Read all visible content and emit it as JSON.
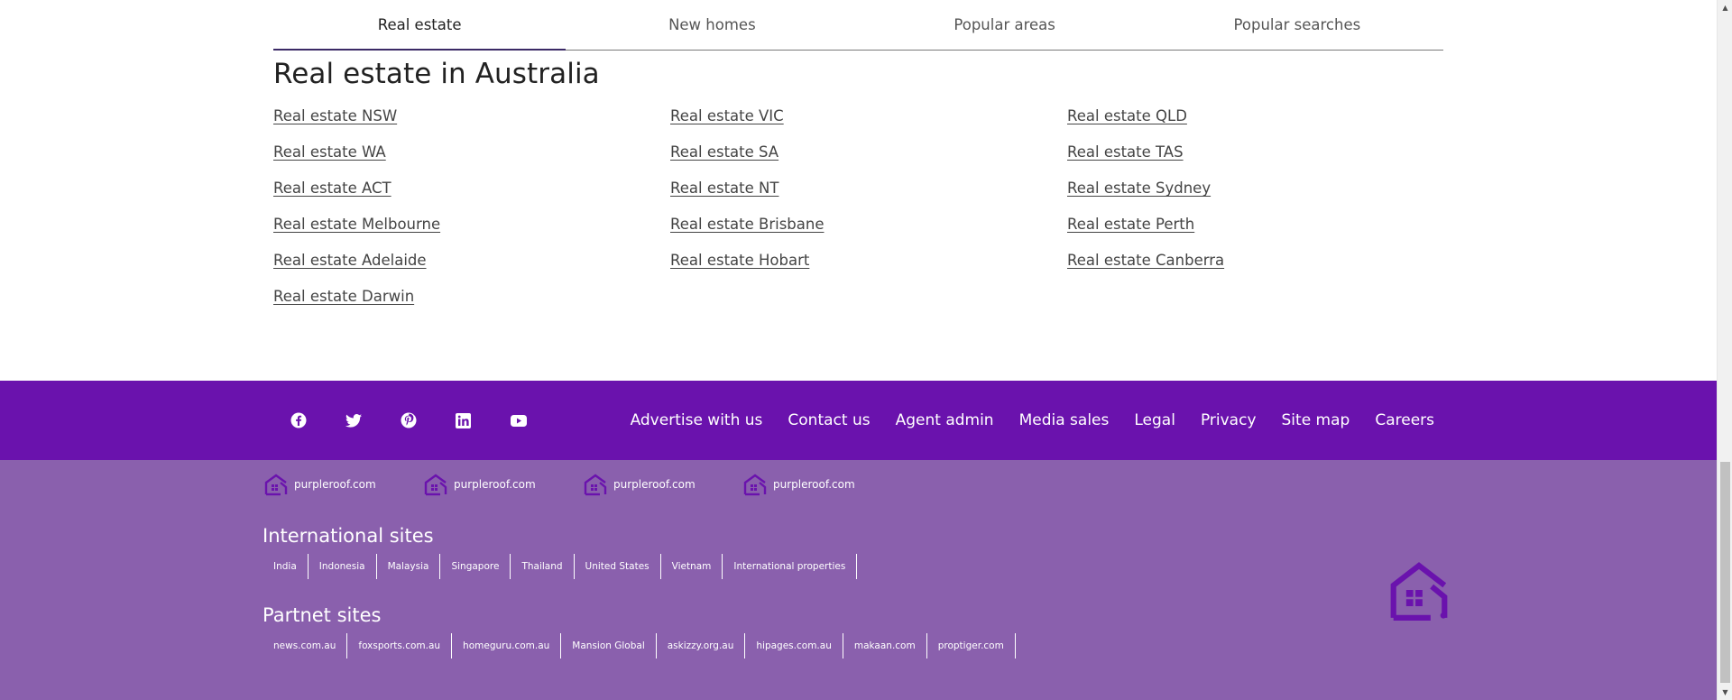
{
  "tabs": [
    {
      "label": "Real estate",
      "active": true
    },
    {
      "label": "New homes",
      "active": false
    },
    {
      "label": "Popular areas",
      "active": false
    },
    {
      "label": "Popular searches",
      "active": false
    }
  ],
  "section": {
    "title": "Real estate in Australia",
    "links": [
      "Real estate NSW",
      "Real estate VIC",
      "Real estate QLD",
      "Real estate WA",
      "Real estate SA",
      "Real estate TAS",
      "Real estate ACT",
      "Real estate NT",
      "Real estate Sydney",
      "Real estate Melbourne",
      "Real estate Brisbane",
      "Real estate Perth",
      "Real estate Adelaide",
      "Real estate Hobart",
      "Real estate Canberra",
      "Real estate Darwin"
    ]
  },
  "footer": {
    "social_icons": [
      "facebook-icon",
      "twitter-icon",
      "pinterest-icon",
      "linkedin-icon",
      "youtube-icon"
    ],
    "links": [
      "Advertise with us",
      "Contact us",
      "Agent admin",
      "Media sales",
      "Legal",
      "Privacy",
      "Site map",
      "Careers"
    ],
    "brands": [
      "purpleroof.com",
      "purpleroof.com",
      "purpleroof.com",
      "purpleroof.com"
    ],
    "international_heading": "International sites",
    "international_sites": [
      "India",
      "Indonesia",
      "Malaysia",
      "Singapore",
      "Thailand",
      "United States",
      "Vietnam",
      "International properties"
    ],
    "partner_heading": "Partnet sites",
    "partner_sites": [
      "news.com.au",
      "foxsports.com.au",
      "homeguru.com.au",
      "Mansion Global",
      "askizzy.org.au",
      "hipages.com.au",
      "makaan.com",
      "proptiger.com"
    ]
  },
  "colors": {
    "footer_top": "#6a12ad",
    "footer_bottom": "#8a60ad",
    "logo": "#6a12ad"
  }
}
